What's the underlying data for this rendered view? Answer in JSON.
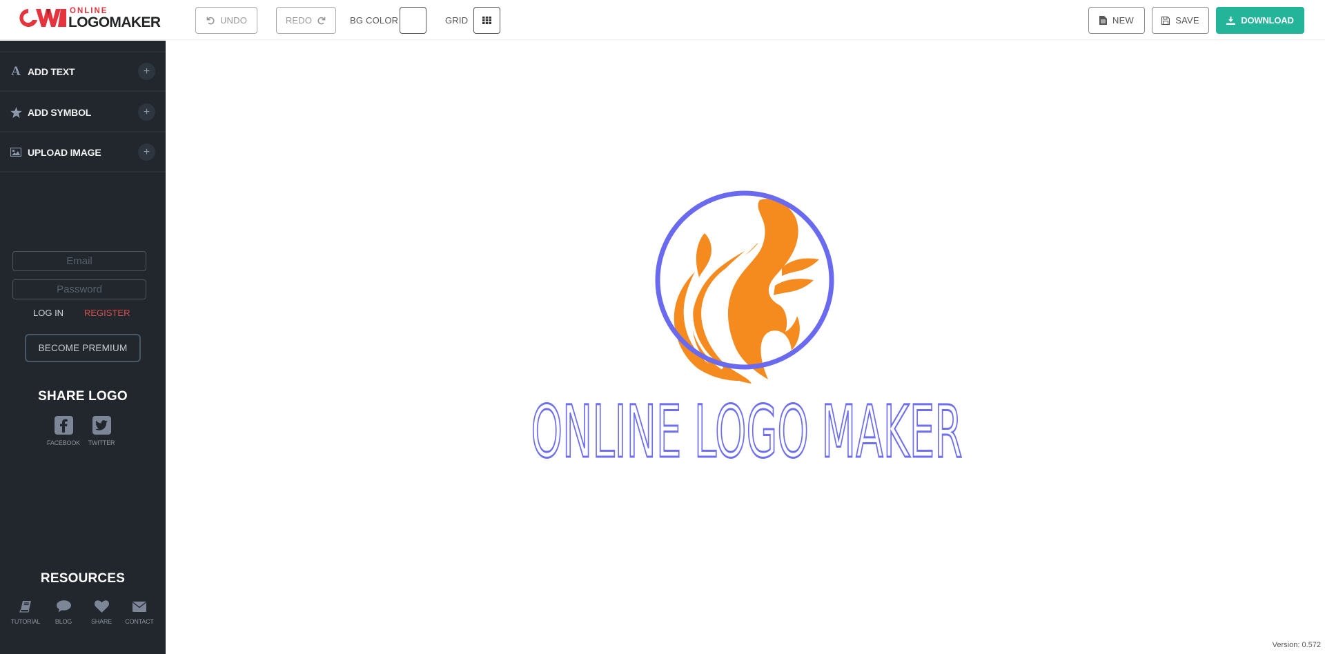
{
  "app": {
    "brand_top": "ONLINE",
    "brand_bottom": "LOGOMAKER",
    "brand_color": "#e5343d"
  },
  "toolbar": {
    "undo_label": "UNDO",
    "redo_label": "REDO",
    "bg_color_label": "BG COLOR",
    "bg_color_value": "#ffffff",
    "grid_label": "GRID",
    "new_label": "NEW",
    "save_label": "SAVE",
    "download_label": "DOWNLOAD",
    "download_color": "#23b49a",
    "icons": {
      "undo": "undo-icon",
      "redo": "redo-icon",
      "grid": "grid-icon",
      "new": "file-icon",
      "save": "floppy-disk-icon",
      "download": "download-icon"
    }
  },
  "sidebar": {
    "items": [
      {
        "label": "ADD TEXT",
        "icon": "text-font-icon"
      },
      {
        "label": "ADD SYMBOL",
        "icon": "star-icon"
      },
      {
        "label": "UPLOAD IMAGE",
        "icon": "image-icon"
      }
    ],
    "login": {
      "email_placeholder": "Email",
      "email_value": "",
      "password_placeholder": "Password",
      "password_value": "",
      "login_label": "LOG IN",
      "register_label": "REGISTER",
      "premium_label": "BECOME PREMIUM"
    },
    "share": {
      "title": "SHARE LOGO",
      "buttons": [
        {
          "label": "FACEBOOK",
          "icon": "facebook-icon"
        },
        {
          "label": "TWITTER",
          "icon": "twitter-icon"
        }
      ]
    },
    "resources": {
      "title": "RESOURCES",
      "buttons": [
        {
          "label": "TUTORIAL",
          "icon": "book-icon"
        },
        {
          "label": "BLOG",
          "icon": "speech-bubble-icon"
        },
        {
          "label": "SHARE",
          "icon": "heart-icon"
        },
        {
          "label": "CONTACT",
          "icon": "envelope-icon"
        }
      ]
    }
  },
  "canvas": {
    "logo_text": "ONLINE LOGO MAKER",
    "text_color": "#6e6ef0",
    "ring_color": "#6a6af0",
    "symbol_color": "#f58a1f",
    "symbol": "phoenix-flame-icon",
    "version": "Version: 0.572"
  }
}
